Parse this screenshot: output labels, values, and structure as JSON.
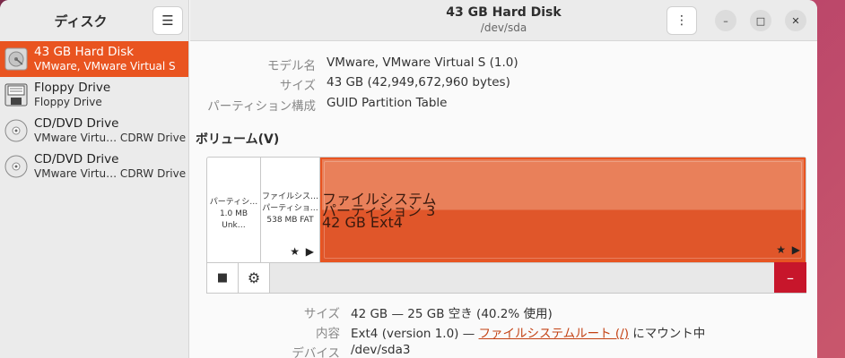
{
  "sidebar": {
    "title": "ディスク",
    "menu_icon": "hamburger-icon",
    "drives": [
      {
        "name": "43 GB Hard Disk",
        "sub": "VMware, VMware Virtual S",
        "icon": "hard-disk-icon",
        "selected": true
      },
      {
        "name": "Floppy Drive",
        "sub": "Floppy Drive",
        "icon": "floppy-icon",
        "selected": false
      },
      {
        "name": "CD/DVD Drive",
        "sub": "VMware Virtu… CDRW Drive",
        "icon": "optical-disc-icon",
        "selected": false
      },
      {
        "name": "CD/DVD Drive",
        "sub": "VMware Virtu… CDRW Drive",
        "icon": "optical-disc-icon",
        "selected": false
      }
    ]
  },
  "header": {
    "title": "43 GB Hard Disk",
    "subtitle": "/dev/sda",
    "more_icon": "⋮",
    "minimize": "–",
    "maximize": "□",
    "close": "✕"
  },
  "disk_info": {
    "model_label": "モデル名",
    "model_value": "VMware, VMware Virtual S (1.0)",
    "size_label": "サイズ",
    "size_value": "43 GB (42,949,672,960 bytes)",
    "partitioning_label": "パーティション構成",
    "partitioning_value": "GUID Partition Table"
  },
  "volumes": {
    "title": "ボリューム(V)",
    "segments": [
      {
        "line1": "パーティシ…",
        "line2": "1.0 MB Unk…"
      },
      {
        "line1": "ファイルシス…",
        "line2": "パーティショ…",
        "line3": "538 MB FAT"
      },
      {
        "line1": "ファイルシステム",
        "line2": "パーティション 3",
        "line3": "42 GB Ext4"
      }
    ],
    "star": "★",
    "play": "▶"
  },
  "toolbar": {
    "stop_icon": "■",
    "gear_icon": "⚙",
    "delete_icon": "–"
  },
  "partition_info": {
    "size_label": "サイズ",
    "size_value": "42 GB — 25 GB 空き (40.2% 使用)",
    "content_label": "内容",
    "content_prefix": "Ext4 (version 1.0) — ",
    "content_link": "ファイルシステムルート (/)",
    "content_suffix": " にマウント中",
    "device_label": "デバイス",
    "device_value": "/dev/sda3"
  },
  "colors": {
    "accent": "#e95420",
    "danger": "#c7162b"
  }
}
